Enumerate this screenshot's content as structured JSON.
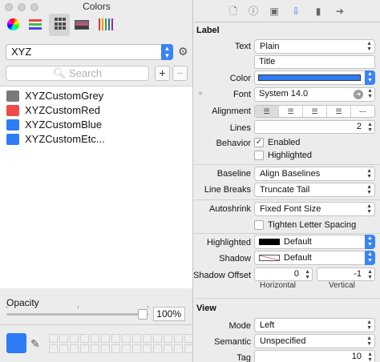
{
  "colors_panel": {
    "title": "Colors",
    "collection": "XYZ",
    "search_placeholder": "Search",
    "add_label": "+",
    "remove_label": "−",
    "items": [
      {
        "name": "XYZCustomGrey",
        "color": "#7a7a7a"
      },
      {
        "name": "XYZCustomRed",
        "color": "#f04b4b"
      },
      {
        "name": "XYZCustomBlue",
        "color": "#2e7cf6"
      },
      {
        "name": "XYZCustomEtc...",
        "color": "#2e7cf6"
      }
    ],
    "opacity_label": "Opacity",
    "opacity_value": "100%",
    "opacity_fraction": 1.0,
    "current_color": "#2e7cf6"
  },
  "inspector": {
    "section_label": "Label",
    "text_label": "Text",
    "text_value": "Plain",
    "title_value": "Title",
    "color_label": "Color",
    "color_value": "#2e7cf6",
    "font_label": "Font",
    "font_value": "System 14.0",
    "alignment_label": "Alignment",
    "alignment_options": [
      "left",
      "center",
      "right",
      "justified",
      "natural"
    ],
    "alignment_selected": 0,
    "lines_label": "Lines",
    "lines_value": "2",
    "behavior_label": "Behavior",
    "enabled_label": "Enabled",
    "enabled_checked": true,
    "highlighted_cb_label": "Highlighted",
    "highlighted_checked": false,
    "baseline_label": "Baseline",
    "baseline_value": "Align Baselines",
    "linebreaks_label": "Line Breaks",
    "linebreaks_value": "Truncate Tail",
    "autoshrink_label": "Autoshrink",
    "autoshrink_value": "Fixed Font Size",
    "tighten_label": "Tighten Letter Spacing",
    "tighten_checked": false,
    "highlighted_label": "Highlighted",
    "highlighted_value": "Default",
    "highlighted_color": "#000000",
    "shadow_label": "Shadow",
    "shadow_value": "Default",
    "shadow_offset_label": "Shadow Offset",
    "shadow_h": "0",
    "shadow_v": "-1",
    "horizontal_label": "Horizontal",
    "vertical_label": "Vertical",
    "view_section": "View",
    "mode_label": "Mode",
    "mode_value": "Left",
    "semantic_label": "Semantic",
    "semantic_value": "Unspecified",
    "tag_label": "Tag",
    "tag_value": "10"
  }
}
